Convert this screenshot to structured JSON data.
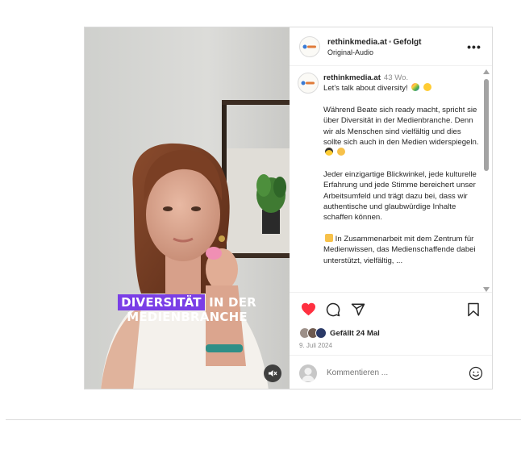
{
  "post": {
    "video": {
      "overlay_highlight": "DIVERSITÄT",
      "overlay_rest": " IN DER",
      "overlay_line2": "MEDIENBRANCHE",
      "muted": true
    },
    "header": {
      "username": "rethinkmedia.at",
      "separator": "•",
      "follow_status": "Gefolgt",
      "audio": "Original-Audio",
      "more": "•••",
      "avatar_logo_text": "rethink"
    },
    "caption": {
      "username": "rethinkmedia.at",
      "time": "43 Wo.",
      "intro": "Let's talk about diversity!",
      "paragraph1": "Während Beate sich ready macht, spricht sie über Diversität in der Medienbranche. Denn wir als Menschen sind vielfältig und dies sollte sich auch in den Medien widerspiegeln.",
      "paragraph2": "Jeder einzigartige Blickwinkel, jede kulturelle Erfahrung und jede Stimme bereichert unser Arbeitsumfeld und trägt dazu bei, dass wir authentische und glaubwürdige Inhalte schaffen können.",
      "paragraph3": "In Zusammenarbeit mit dem Zentrum für Medienwissen, das Medienschaffende dabei unterstützt, vielfältig, ..."
    },
    "likes": "Gefällt 24 Mal",
    "date": "9. Juli 2024",
    "comment_placeholder": "Kommentieren ...",
    "colors": {
      "like_heart": "#ff3040",
      "highlight": "#7a3ee6",
      "muted_text": "#8e8e8e"
    },
    "icons": [
      "heart-icon",
      "comment-icon",
      "share-icon",
      "bookmark-icon",
      "emoji-icon",
      "mute-icon",
      "more-icon"
    ]
  }
}
